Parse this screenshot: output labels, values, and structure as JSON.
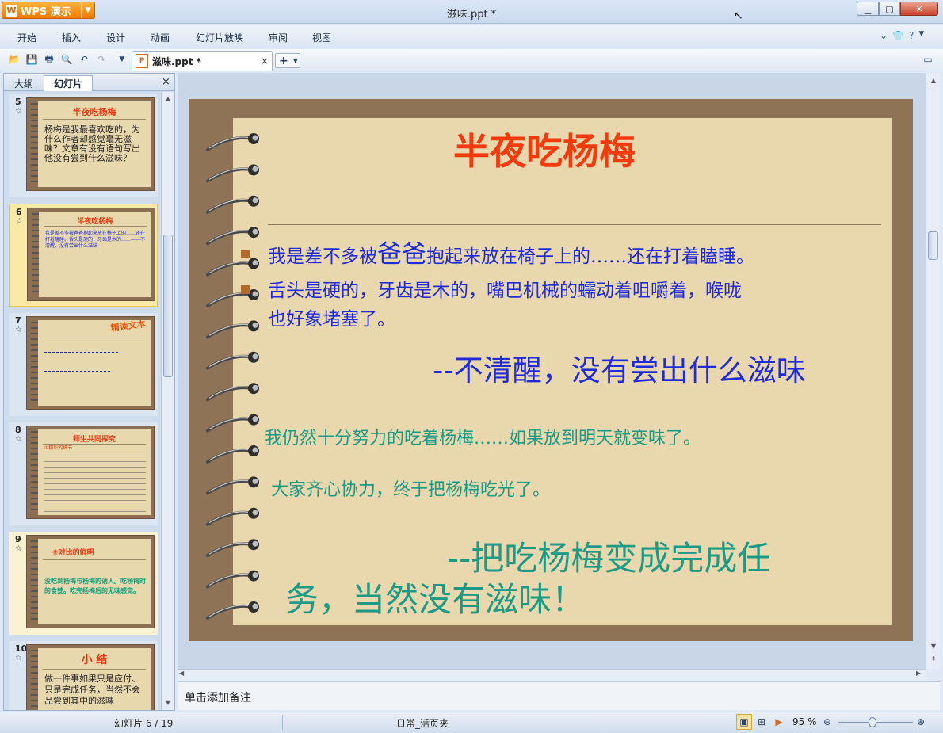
{
  "app": {
    "logo_label": "WPS 演示",
    "window_title": "滋味.ppt *"
  },
  "menu": [
    "开始",
    "插入",
    "设计",
    "动画",
    "幻灯片放映",
    "审阅",
    "视图"
  ],
  "doc_tab": {
    "label": "滋味.ppt *",
    "close": "×"
  },
  "panel": {
    "tab_outline": "大纲",
    "tab_slides": "幻灯片",
    "close": "×"
  },
  "thumbs": [
    {
      "num": "5",
      "title": "半夜吃杨梅",
      "body": "杨梅是我最喜欢吃的，为什么作者却感觉毫无滋味？文章有没有语句写出他没有尝到什么滋味？"
    },
    {
      "num": "6",
      "title": "半夜吃杨梅",
      "body": "我是差不多被爸爸抱起来放在椅子上的……还在打着瞌睡。舌头是硬的，牙齿是木的……——不清醒，没有尝出什么滋味"
    },
    {
      "num": "7",
      "title": "精读文本",
      "body": ""
    },
    {
      "num": "8",
      "title": "师生共同探究",
      "body": "①精彩的细节"
    },
    {
      "num": "9",
      "title": "②对比的鲜明",
      "body": "没吃到杨梅与杨梅的诱人。吃杨梅时的食婪。吃完杨梅后的无味感觉。"
    },
    {
      "num": "10",
      "title": "小 结",
      "body": "做一件事如果只是应付、只是完成任务，当然不会品尝到其中的滋味"
    }
  ],
  "slide": {
    "title": "半夜吃杨梅",
    "line1_a": "我是差不多被",
    "line1_big": "爸爸",
    "line1_b": "抱起来放在椅子上的……还在打着瞌睡。",
    "line2": "舌头是硬的，牙齿是木的，嘴巴机械的蠕动着咀嚼着，喉咙",
    "line3": "也好象堵塞了。",
    "line4": "--不清醒，没有尝出什么滋味",
    "line5": "我仍然十分努力的吃着杨梅……如果放到明天就变味了。",
    "line6": "大家齐心协力，终于把杨梅吃光了。",
    "line7": "--把吃杨梅变成完成任",
    "line8": "务，当然没有滋味！"
  },
  "notes_placeholder": "单击添加备注",
  "status": {
    "slide_counter": "幻灯片 6 / 19",
    "theme": "日常_活页夹",
    "zoom": "95 %"
  },
  "colors": {
    "accent": "#f07a00",
    "slide_title": "#f23a0d",
    "blue_text": "#1f2adb",
    "teal_text": "#1c9a85"
  }
}
